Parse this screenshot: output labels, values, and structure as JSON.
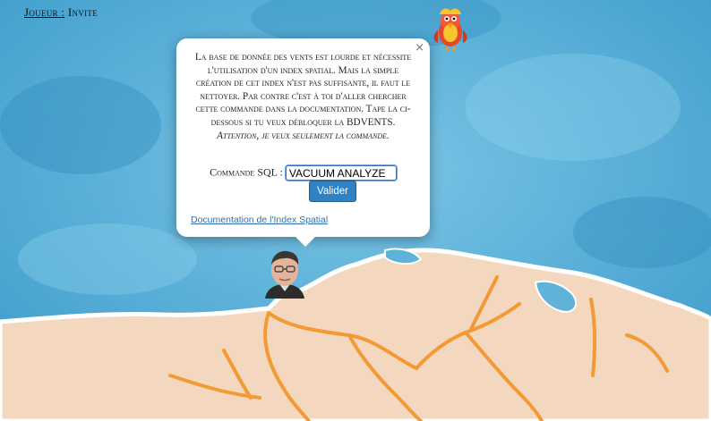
{
  "header": {
    "player_label": "Joueur :",
    "player_name": "Invite"
  },
  "popup": {
    "close_label": "×",
    "message": "La base de donnée des vents est lourde et nécessite l'utilisation d'un index spatial. Mais la simple création de cet index n'est pas suffisante, il faut le nettoyer. Par contre c'est à toi d'aller chercher cette commande dans la documentation. Tape la ci-dessous si tu veux débloquer la BDVENTS.",
    "warning": "Attention, je veux seulement la commande.",
    "command_label": "Commande SQL :",
    "command_value": "VACUUM ANALYZE",
    "submit_label": "Valider",
    "doc_link": "Documentation de l'Index Spatial"
  },
  "icons": {
    "mascot": "parrot-icon",
    "player": "player-avatar",
    "close": "close-icon"
  },
  "colors": {
    "sea": "#5fb3d8",
    "land": "#f3d8bf",
    "roads": "#f39a35",
    "button": "#2f83c5"
  }
}
